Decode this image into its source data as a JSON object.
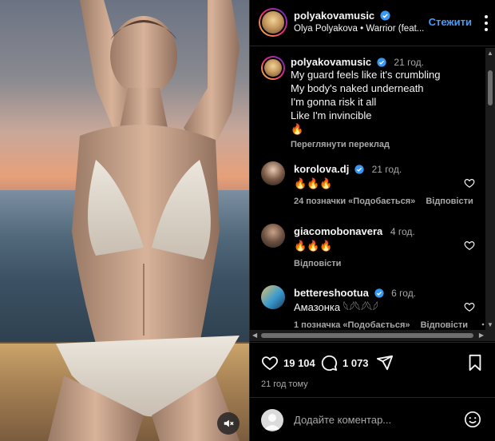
{
  "media": {
    "mute_icon": "speaker-muted-icon"
  },
  "header": {
    "username": "polyakovamusic",
    "song": "Olya Polyakova • Warrior (feat...",
    "follow_label": "Стежити",
    "more_icon": "more-icon"
  },
  "caption": {
    "username": "polyakovamusic",
    "time": "21 год.",
    "lines": [
      "My guard feels like it's crumbling",
      "My body's naked underneath",
      "I'm gonna risk it all",
      "Like I'm invincible",
      "🔥"
    ],
    "translate": "Переглянути переклад"
  },
  "comments": [
    {
      "username": "korolova.dj",
      "verified": true,
      "time": "21 год.",
      "text": "🔥🔥🔥",
      "likes": "24 позначки «Подобається»",
      "reply": "Відповісти"
    },
    {
      "username": "giacomobonavera",
      "verified": false,
      "time": "4 год.",
      "text": "🔥🔥🔥",
      "likes": "",
      "reply": "Відповісти"
    },
    {
      "username": "betteresh​ootua",
      "verified": true,
      "time": "6 год.",
      "text": "Амазонка 𓆩𓆪𓆩𓆪𓆩𓆪",
      "likes": "1 позначка «Подобається»",
      "reply": "Відповісти"
    }
  ],
  "actions": {
    "likes_count": "19 104",
    "comments_count": "1 073",
    "time_ago": "21 год тому"
  },
  "comment_box": {
    "placeholder": "Додайте коментар..."
  },
  "colors": {
    "accent": "#4a9bf5",
    "background": "#000000",
    "secondary_text": "#a8a8a8",
    "verified": "#3897f0"
  }
}
